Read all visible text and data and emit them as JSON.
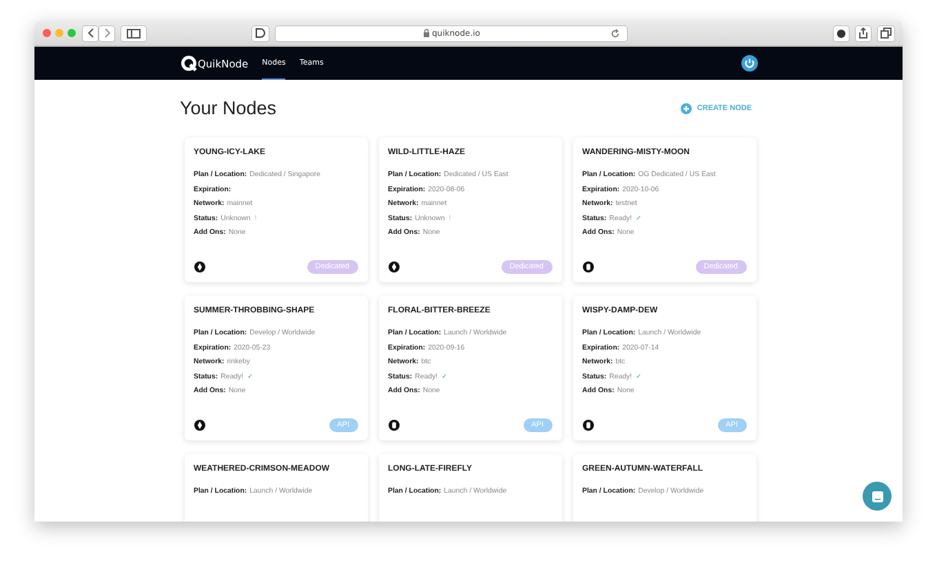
{
  "browser": {
    "url": "quiknode.io"
  },
  "nav": {
    "brand": "QuikNode",
    "links": [
      {
        "label": "Nodes",
        "selected": true
      },
      {
        "label": "Teams",
        "selected": false
      }
    ]
  },
  "page": {
    "title": "Your Nodes",
    "create_button": "CREATE NODE"
  },
  "nodes": [
    {
      "name": "YOUNG-ICY-LAKE",
      "fields": [
        {
          "label": "Plan / Location:",
          "value": "Dedicated / Singapore"
        },
        {
          "label": "Expiration:"
        },
        {
          "label": "Network:",
          "value": "mainnet"
        }
      ],
      "status": {
        "label": "Status:",
        "value": "Unknown",
        "mark": "!",
        "kind": "unknown"
      },
      "addons": {
        "label": "Add Ons:",
        "value": "None"
      },
      "chain_icon": {
        "kind": "diamond"
      },
      "badge": {
        "label": "Dedicated",
        "kind": "dedicated"
      }
    },
    {
      "name": "WILD-LITTLE-HAZE",
      "fields": [
        {
          "label": "Plan / Location:",
          "value": "Dedicated / US East"
        },
        {
          "label": "Expiration:",
          "value": "2020-08-06"
        },
        {
          "label": "Network:",
          "value": "mainnet"
        }
      ],
      "status": {
        "label": "Status:",
        "value": "Unknown",
        "mark": "!",
        "kind": "unknown"
      },
      "addons": {
        "label": "Add Ons:",
        "value": "None"
      },
      "chain_icon": {
        "kind": "diamond"
      },
      "badge": {
        "label": "Dedicated",
        "kind": "dedicated"
      }
    },
    {
      "name": "WANDERING-MISTY-MOON",
      "fields": [
        {
          "label": "Plan / Location:",
          "value": "OG Dedicated / US East"
        },
        {
          "label": "Expiration:",
          "value": "2020-10-06"
        },
        {
          "label": "Network:",
          "value": "testnet"
        }
      ],
      "status": {
        "label": "Status:",
        "value": "Ready!",
        "mark": "✓",
        "kind": "ready"
      },
      "addons": {
        "label": "Add Ons:",
        "value": "None"
      },
      "chain_icon": {
        "kind": "coin"
      },
      "badge": {
        "label": "Dedicated",
        "kind": "dedicated"
      }
    },
    {
      "name": "SUMMER-THROBBING-SHAPE",
      "fields": [
        {
          "label": "Plan / Location:",
          "value": "Develop / Worldwide"
        },
        {
          "label": "Expiration:",
          "value": "2020-05-23"
        },
        {
          "label": "Network:",
          "value": "rinkeby"
        }
      ],
      "status": {
        "label": "Status:",
        "value": "Ready!",
        "mark": "✓",
        "kind": "ready"
      },
      "addons": {
        "label": "Add Ons:",
        "value": "None"
      },
      "chain_icon": {
        "kind": "diamond"
      },
      "badge": {
        "label": "API",
        "kind": "api"
      }
    },
    {
      "name": "FLORAL-BITTER-BREEZE",
      "fields": [
        {
          "label": "Plan / Location:",
          "value": "Launch / Worldwide"
        },
        {
          "label": "Expiration:",
          "value": "2020-09-16"
        },
        {
          "label": "Network:",
          "value": "btc"
        }
      ],
      "status": {
        "label": "Status:",
        "value": "Ready!",
        "mark": "✓",
        "kind": "ready"
      },
      "addons": {
        "label": "Add Ons:",
        "value": "None"
      },
      "chain_icon": {
        "kind": "coin"
      },
      "badge": {
        "label": "API",
        "kind": "api"
      }
    },
    {
      "name": "WISPY-DAMP-DEW",
      "fields": [
        {
          "label": "Plan / Location:",
          "value": "Launch / Worldwide"
        },
        {
          "label": "Expiration:",
          "value": "2020-07-14"
        },
        {
          "label": "Network:",
          "value": "btc"
        }
      ],
      "status": {
        "label": "Status:",
        "value": "Ready!",
        "mark": "✓",
        "kind": "ready"
      },
      "addons": {
        "label": "Add Ons:",
        "value": "None"
      },
      "chain_icon": {
        "kind": "coin"
      },
      "badge": {
        "label": "API",
        "kind": "api"
      }
    },
    {
      "name": "WEATHERED-CRIMSON-MEADOW",
      "fields": [
        {
          "label": "Plan / Location:",
          "value": "Launch / Worldwide"
        }
      ]
    },
    {
      "name": "LONG-LATE-FIREFLY",
      "fields": [
        {
          "label": "Plan / Location:",
          "value": "Launch / Worldwide"
        }
      ]
    },
    {
      "name": "GREEN-AUTUMN-WATERFALL",
      "fields": [
        {
          "label": "Plan / Location:",
          "value": "Develop / Worldwide"
        }
      ]
    }
  ]
}
